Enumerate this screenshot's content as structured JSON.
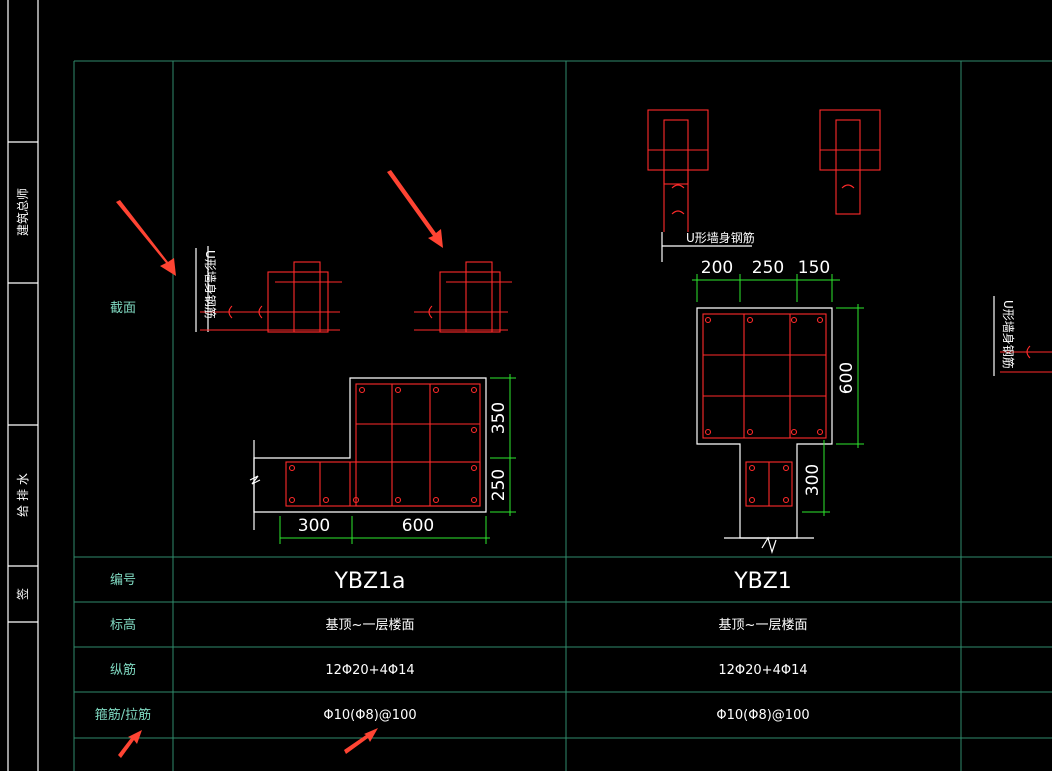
{
  "left_strip": {
    "top_text": "建筑总师",
    "mid_text": "给 排 水",
    "bottom_text": "签"
  },
  "table": {
    "row_labels": {
      "section": "截面",
      "code": "编号",
      "elevation": "标高",
      "long_bar": "纵筋",
      "stirrup": "箍筋/拉筋"
    },
    "columns": [
      {
        "code": "YBZ1a",
        "elevation": "基顶~一层楼面",
        "long_bar": "12Φ20+4Φ14",
        "stirrup": "Φ10(Φ8)@100",
        "dims": {
          "h1": "350",
          "h2": "250",
          "w1": "300",
          "w2": "600"
        }
      },
      {
        "code": "YBZ1",
        "elevation": "基顶~一层楼面",
        "long_bar": "12Φ20+4Φ14",
        "stirrup": "Φ10(Φ8)@100",
        "dims": {
          "w1": "200",
          "w2": "250",
          "w3": "150",
          "h1": "600",
          "h2": "300"
        }
      }
    ],
    "u_bar_label": "U形墙身钢筋"
  },
  "colors": {
    "background": "#000000",
    "grid_line": "#2f8a6b",
    "outline": "#ffffff",
    "rebar": "#ff2a2a",
    "dimension": "#2ee82e",
    "annotation_arrow": "#ff4433",
    "label_text": "#7fd8c0"
  }
}
